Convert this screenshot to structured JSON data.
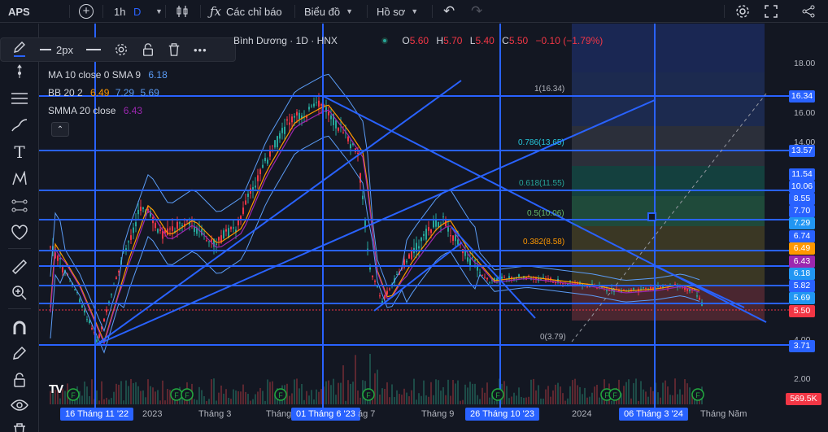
{
  "topbar": {
    "symbol": "APS",
    "interval": "1h",
    "interval_d": "D",
    "indicators_label": "Các chỉ báo",
    "charts_label": "Biểu đồ",
    "profile_label": "Hồ sơ"
  },
  "drawbar": {
    "width_label": "2px"
  },
  "legend": {
    "title_fragment": "Bình Dương · 1D · HNX",
    "ohlc": {
      "o_label": "O",
      "o": "5.60",
      "h_label": "H",
      "h": "5.70",
      "l_label": "L",
      "l": "5.40",
      "c_label": "C",
      "c": "5.50",
      "change": "−0.10 (−1.79%)"
    },
    "indicators": [
      {
        "name": "MA 10 close 0 SMA 9",
        "values": [
          "6.18"
        ],
        "colors": [
          "#5b9cf6"
        ]
      },
      {
        "name": "BB 20 2",
        "values": [
          "6.49",
          "7.29",
          "5.69"
        ],
        "colors": [
          "#ff9800",
          "#5b9cf6",
          "#5b9cf6"
        ]
      },
      {
        "name": "SMMA 20 close",
        "values": [
          "6.43"
        ],
        "colors": [
          "#9c27b0"
        ]
      }
    ]
  },
  "price_axis": {
    "ticks": [
      "18.00",
      "16.00",
      "14.00",
      "4.00",
      "2.00"
    ],
    "labels": [
      {
        "text": "16.34",
        "color": "#2962ff"
      },
      {
        "text": "13.57",
        "color": "#2962ff"
      },
      {
        "text": "11.54",
        "color": "#2962ff"
      },
      {
        "text": "10.06",
        "color": "#2962ff"
      },
      {
        "text": "8.55",
        "color": "#2962ff"
      },
      {
        "text": "7.70",
        "color": "#2962ff"
      },
      {
        "text": "7.29",
        "color": "#2196f3"
      },
      {
        "text": "6.74",
        "color": "#2962ff"
      },
      {
        "text": "6.49",
        "color": "#ff9800"
      },
      {
        "text": "6.43",
        "color": "#9c27b0"
      },
      {
        "text": "6.18",
        "color": "#2196f3"
      },
      {
        "text": "5.82",
        "color": "#2962ff"
      },
      {
        "text": "5.69",
        "color": "#2196f3"
      },
      {
        "text": "5.50",
        "color": "#f23645"
      },
      {
        "text": "3.71",
        "color": "#2962ff"
      },
      {
        "text": "569.5K",
        "color": "#f23645"
      }
    ]
  },
  "time_axis": [
    {
      "text": "16 Tháng 11 '22",
      "highlight": true
    },
    {
      "text": "2023",
      "highlight": false
    },
    {
      "text": "Tháng 3",
      "highlight": false
    },
    {
      "text": "Tháng",
      "highlight": false
    },
    {
      "text": "01 Tháng 6 '23",
      "highlight": true
    },
    {
      "text": "ág 7",
      "highlight": false
    },
    {
      "text": "Tháng 9",
      "highlight": false
    },
    {
      "text": "26 Tháng 10 '23",
      "highlight": true
    },
    {
      "text": "2024",
      "highlight": false
    },
    {
      "text": "06 Tháng 3 '24",
      "highlight": true
    },
    {
      "text": "Tháng Năm",
      "highlight": false
    }
  ],
  "fib": [
    {
      "text": "1(16.34)",
      "color": "#b2b5be"
    },
    {
      "text": "0.786(13.65)",
      "color": "#26c6da"
    },
    {
      "text": "0.618(11.55)",
      "color": "#26a69a"
    },
    {
      "text": "0.5(10.06)",
      "color": "#66bb6a"
    },
    {
      "text": "0.382(8.58)",
      "color": "#ff9800"
    },
    {
      "text": "0(3.79)",
      "color": "#b2b5be"
    }
  ],
  "colors": {
    "line": "#2962ff",
    "bg": "#131722",
    "up": "#26a69a",
    "down": "#f23645"
  }
}
